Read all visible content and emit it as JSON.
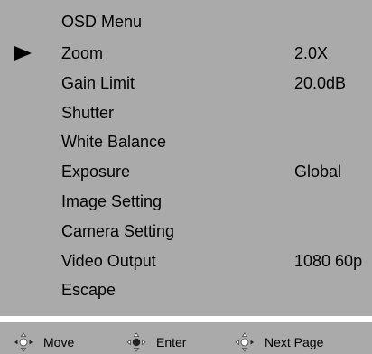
{
  "menu": {
    "title": "OSD Menu",
    "items": [
      {
        "label": "Zoom",
        "value": "2.0X",
        "selected": true
      },
      {
        "label": "Gain Limit",
        "value": "20.0dB",
        "selected": false
      },
      {
        "label": "Shutter",
        "value": "",
        "selected": false
      },
      {
        "label": "White Balance",
        "value": "",
        "selected": false
      },
      {
        "label": "Exposure",
        "value": "Global",
        "selected": false
      },
      {
        "label": "Image Setting",
        "value": "",
        "selected": false
      },
      {
        "label": "Camera Setting",
        "value": "",
        "selected": false
      },
      {
        "label": "Video Output",
        "value": "1080 60p",
        "selected": false
      },
      {
        "label": "Escape",
        "value": "",
        "selected": false
      }
    ]
  },
  "footer": {
    "move_label": "Move",
    "move_icon": "dpad-left-right-icon",
    "enter_label": "Enter",
    "enter_icon": "dpad-center-icon",
    "next_page_label": "Next Page",
    "next_page_icon": "dpad-right-icon"
  },
  "colors": {
    "panel": "#aaaaaa",
    "text": "#000000",
    "divider": "#ffffff"
  }
}
